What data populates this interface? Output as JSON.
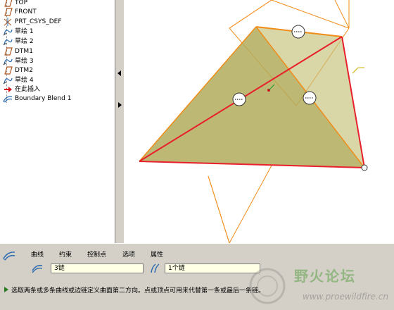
{
  "model_tree": {
    "items": [
      {
        "label": "TOP",
        "icon": "datum-plane-icon"
      },
      {
        "label": "FRONT",
        "icon": "datum-plane-icon"
      },
      {
        "label": "PRT_CSYS_DEF",
        "icon": "csys-icon"
      },
      {
        "label": "草绘 1",
        "icon": "sketch-icon"
      },
      {
        "label": "草绘 2",
        "icon": "sketch-icon"
      },
      {
        "label": "DTM1",
        "icon": "datum-plane-icon"
      },
      {
        "label": "草绘 3",
        "icon": "sketch-icon"
      },
      {
        "label": "DTM2",
        "icon": "datum-plane-icon"
      },
      {
        "label": "草绘 4",
        "icon": "sketch-icon"
      },
      {
        "label": "在此插入",
        "icon": "insert-here-icon"
      },
      {
        "label": "Boundary Blend 1",
        "icon": "boundary-blend-icon"
      }
    ]
  },
  "dashboard": {
    "tabs": [
      "曲线",
      "约束",
      "控制点",
      "选项",
      "属性"
    ],
    "first_direction_value": "3链",
    "second_direction_value": "1个链"
  },
  "status": {
    "message": "选取两条或多条曲线或边链定义曲面第二方向。点或顶点可用来代替第一条或最后一条链。"
  },
  "viewport": {
    "selected_color": "#e8202a",
    "surface_color": "#c4c07a",
    "edge_color": "#f08c18"
  },
  "watermark": {
    "title": "野火论坛",
    "url": "www.proewildfire.cn"
  }
}
